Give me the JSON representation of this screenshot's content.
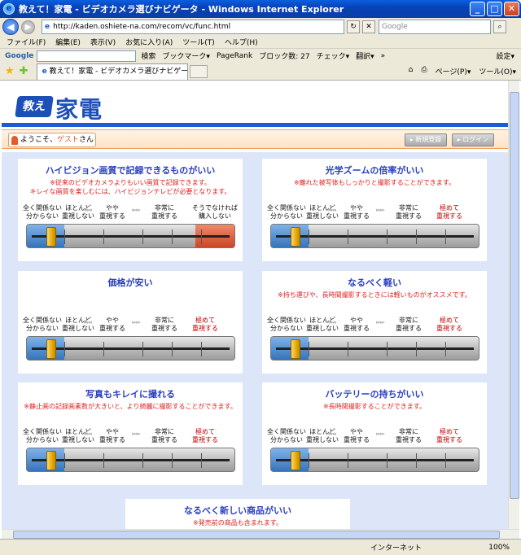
{
  "window": {
    "title": "教えて！家電 - ビデオカメラ選びナビゲータ - Windows Internet Explorer",
    "min": "_",
    "max": "□",
    "close": "✕"
  },
  "address": {
    "url": "http://kaden.oshiete-na.com/recom/vc/func.html",
    "search_placeholder": "Google"
  },
  "menu": [
    "ファイル(F)",
    "編集(E)",
    "表示(V)",
    "お気に入り(A)",
    "ツール(T)",
    "ヘルプ(H)"
  ],
  "google_bar": {
    "brand": "Google",
    "items": [
      "検索",
      "ブックマーク▾",
      "PageRank",
      "ブロック数: 27",
      "チェック▾",
      "翻訳▾",
      "»",
      "設定▾"
    ]
  },
  "tab": {
    "title": "教えて！家電 - ビデオカメラ選びナビゲータ",
    "tools": [
      "ページ(P)▾",
      "ツール(O)▾"
    ]
  },
  "header": {
    "logo_sub": "教えて!",
    "logo_main": "家電",
    "welcome_prefix": "ようこそ、",
    "welcome_user": "ゲスト",
    "welcome_suffix": "さん",
    "register": "新規登録",
    "login": "ログイン"
  },
  "scale": {
    "lbl1": "全く関係ない\n分からない",
    "lbl2": "ほとんど\n重視しない",
    "lbl3": "やや\n重視する",
    "lbl4": "非常に\n重視する",
    "lbl5": "極めて\n重視する",
    "lbl5_alt": "そうでなければ\n購入しない",
    "arrow_left": "◂◂◂◂",
    "arrow_right": "▸▸▸▸"
  },
  "cards": [
    {
      "title": "ハイビジョン画質で記録できるものがいい",
      "desc": "※従来のビデオカメラよりもいい画質で記録できます。\nキレイな画質を楽しむには、ハイビジョンテレビが必要となります。",
      "selected_level": 1
    },
    {
      "title": "光学ズームの倍率がいい",
      "desc": "※離れた被写体もしっかりと撮影することができます。",
      "selected_level": 1
    },
    {
      "title": "価格が安い",
      "desc": "",
      "selected_level": 1
    },
    {
      "title": "なるべく軽い",
      "desc": "※持ち運びや、長時間撮影するときには軽いものがオススメです。",
      "selected_level": 1
    },
    {
      "title": "写真もキレイに撮れる",
      "desc": "※静止画の記録画素数が大きいと、より綺麗に撮影することができます。",
      "selected_level": 1
    },
    {
      "title": "バッテリーの持ちがいい",
      "desc": "※長時間撮影することができます。",
      "selected_level": 1
    },
    {
      "title": "なるべく新しい商品がいい",
      "desc": "※発売前の商品も含まれます。"
    }
  ],
  "status": {
    "zone": "インターネット",
    "zoom": "100%"
  }
}
